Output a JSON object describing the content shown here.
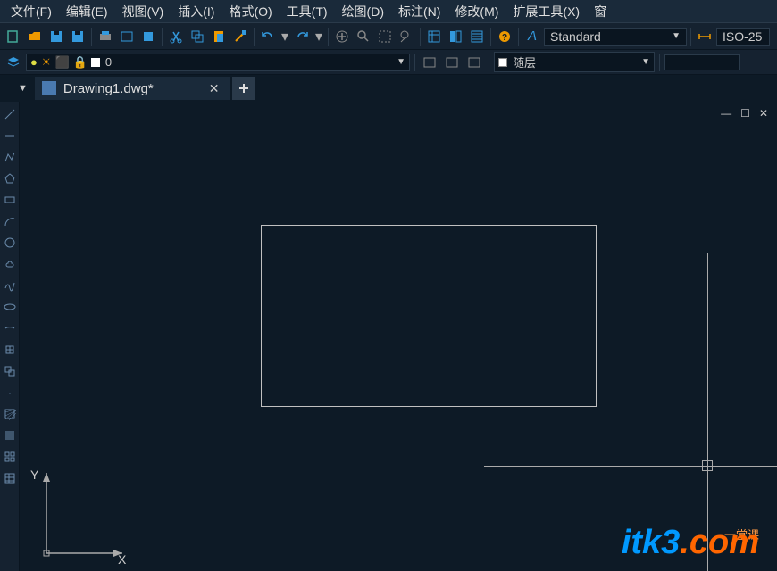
{
  "menu": [
    "文件(F)",
    "编辑(E)",
    "视图(V)",
    "插入(I)",
    "格式(O)",
    "工具(T)",
    "绘图(D)",
    "标注(N)",
    "修改(M)",
    "扩展工具(X)",
    "窗"
  ],
  "style_dropdown": {
    "value": "Standard"
  },
  "dimstyle_dropdown": {
    "value": "ISO-25"
  },
  "layer_combo": {
    "value": "0"
  },
  "byLayer_combo": {
    "value": "随层"
  },
  "tab": {
    "name": "Drawing1.dwg*",
    "close": "✕",
    "add_icon": "+"
  },
  "ucs": {
    "x": "X",
    "y": "Y"
  },
  "watermark": {
    "brand": "itk3",
    "dot": ".",
    "com": "com",
    "sub": "一堂课"
  },
  "colors": {
    "canvas": "#0d1a26"
  }
}
